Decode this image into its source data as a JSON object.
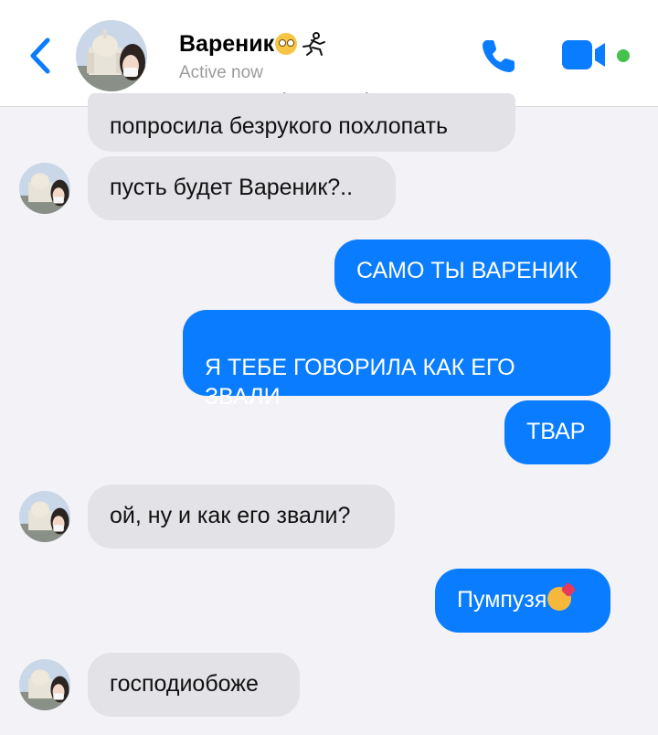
{
  "header": {
    "contact_name": "Вареник",
    "status": "Active now",
    "watermark": "Chat Story Maker",
    "title_emojis": [
      "rolling-eyes-emoji",
      "runner-emoji"
    ]
  },
  "messages": [
    {
      "side": "in",
      "text": "попросила безрукого похлопать"
    },
    {
      "side": "in",
      "text": "пусть будет Вареник?.."
    },
    {
      "side": "out",
      "text": "САМО ТЫ ВАРЕНИК"
    },
    {
      "side": "out",
      "text": "Я ТЕБЕ ГОВОРИЛА КАК ЕГО\nЗВАЛИ"
    },
    {
      "side": "out",
      "text": "ТВАР"
    },
    {
      "side": "in",
      "text": "ой, ну и как его звали?"
    },
    {
      "side": "out",
      "text": "Пумпузя",
      "emoji": "hugging-face-emoji"
    },
    {
      "side": "in",
      "text": "господиобоже"
    }
  ],
  "colors": {
    "accent": "#0a7cff",
    "incoming_bubble": "#e2e2e7",
    "online_dot": "#44c24b",
    "background": "#f2f2f7"
  }
}
